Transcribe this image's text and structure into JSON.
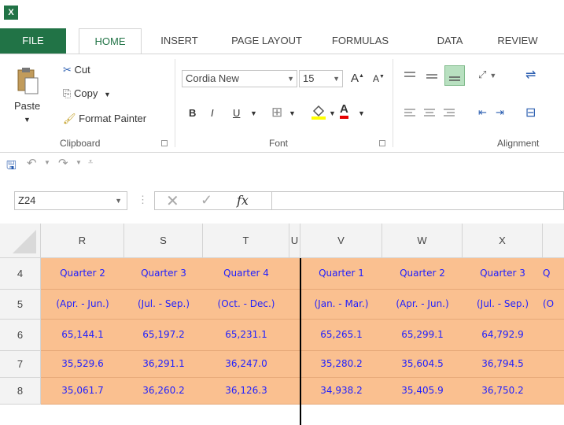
{
  "app": {
    "logo_text": "X"
  },
  "tabs": [
    {
      "label": "FILE"
    },
    {
      "label": "HOME"
    },
    {
      "label": "INSERT"
    },
    {
      "label": "PAGE LAYOUT"
    },
    {
      "label": "FORMULAS"
    },
    {
      "label": "DATA"
    },
    {
      "label": "REVIEW"
    }
  ],
  "clipboard": {
    "paste_label": "Paste",
    "cut_label": "Cut",
    "copy_label": "Copy",
    "format_painter_label": "Format Painter",
    "group_label": "Clipboard"
  },
  "font": {
    "font_name": "Cordia New",
    "font_size": "15",
    "bold": "B",
    "italic": "I",
    "underline": "U",
    "group_label": "Font",
    "grow_glyph": "A",
    "shrink_glyph": "A",
    "color_glyph": "A"
  },
  "alignment": {
    "group_label": "Alignment"
  },
  "formula_bar": {
    "name_box": "Z24",
    "fx": "fx",
    "formula": ""
  },
  "grid": {
    "columns": [
      {
        "label": "R"
      },
      {
        "label": "S"
      },
      {
        "label": "T"
      },
      {
        "label": "U"
      },
      {
        "label": "V"
      },
      {
        "label": "W"
      },
      {
        "label": "X"
      }
    ],
    "rows": [
      {
        "num": "4",
        "cells": [
          "Quarter 2",
          "Quarter 3",
          "Quarter 4",
          "",
          "Quarter 1",
          "Quarter 2",
          "Quarter 3",
          "Q"
        ]
      },
      {
        "num": "5",
        "cells": [
          "(Apr. - Jun.)",
          "(Jul. - Sep.)",
          "(Oct. - Dec.)",
          "",
          "(Jan. - Mar.)",
          "(Apr. - Jun.)",
          "(Jul. - Sep.)",
          "(O"
        ]
      },
      {
        "num": "6",
        "cells": [
          "65,144.1",
          "65,197.2",
          "65,231.1",
          "",
          "65,265.1",
          "65,299.1",
          "64,792.9",
          ""
        ]
      },
      {
        "num": "7",
        "cells": [
          "35,529.6",
          "36,291.1",
          "36,247.0",
          "",
          "35,280.2",
          "35,604.5",
          "36,794.5",
          ""
        ]
      },
      {
        "num": "8",
        "cells": [
          "35,061.7",
          "36,260.2",
          "36,126.3",
          "",
          "34,938.2",
          "35,405.9",
          "36,750.2",
          ""
        ]
      }
    ]
  },
  "colors": {
    "accent": "#217346",
    "cell_fill": "#fac090",
    "cell_text": "#1f1fff"
  }
}
